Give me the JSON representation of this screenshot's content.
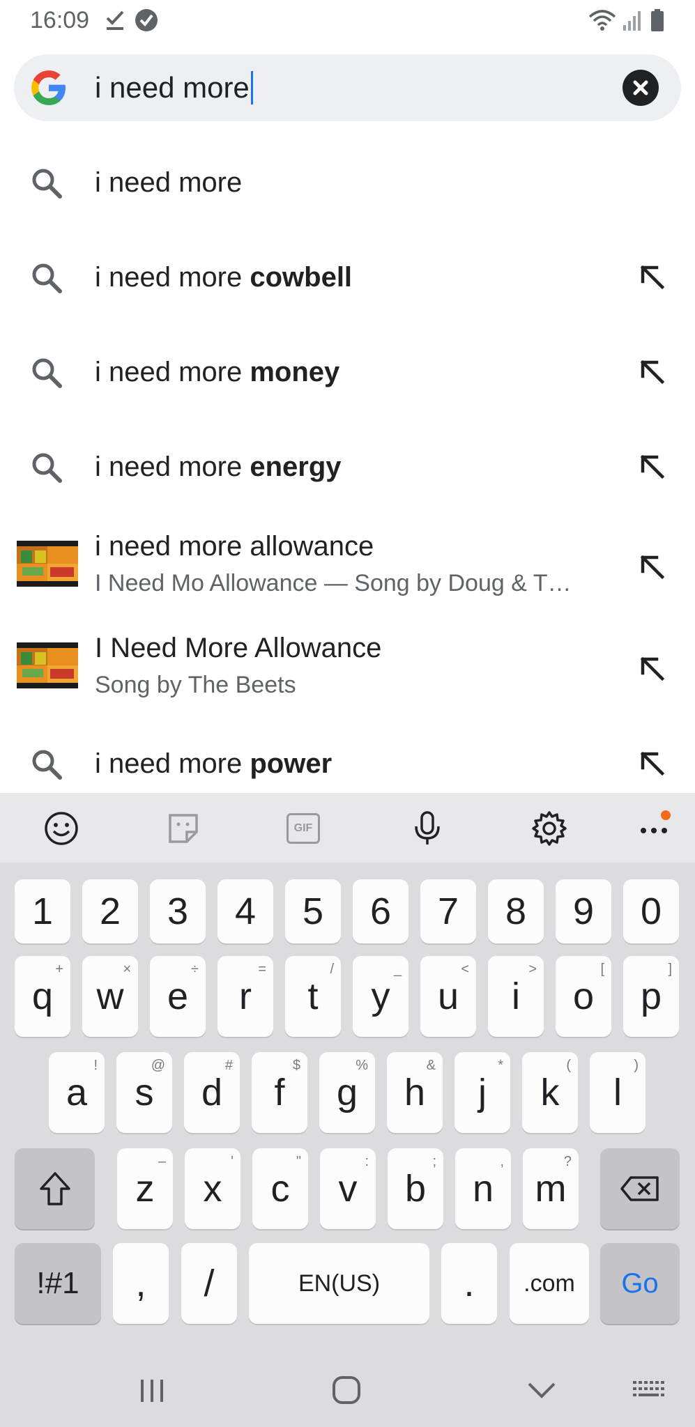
{
  "status_bar": {
    "time": "16:09"
  },
  "search": {
    "query": "i need more"
  },
  "suggestions": [
    {
      "type": "query",
      "prefix": "i need more",
      "bold": ""
    },
    {
      "type": "query",
      "prefix": "i need more ",
      "bold": "cowbell"
    },
    {
      "type": "query",
      "prefix": "i need more ",
      "bold": "money"
    },
    {
      "type": "query",
      "prefix": "i need more ",
      "bold": "energy"
    },
    {
      "type": "media",
      "title": "i need more allowance",
      "subtitle": "I Need Mo Allowance — Song by Doug & T…"
    },
    {
      "type": "media",
      "title": "I Need More Allowance",
      "subtitle": "Song by The Beets"
    },
    {
      "type": "query",
      "prefix": "i need more ",
      "bold": "power"
    }
  ],
  "keyboard": {
    "toolbar": [
      "emoji-icon",
      "sticker-icon",
      "gif-icon",
      "microphone-icon",
      "settings-icon",
      "more-icon"
    ],
    "gif_label": "GIF",
    "number_row": [
      "1",
      "2",
      "3",
      "4",
      "5",
      "6",
      "7",
      "8",
      "9",
      "0"
    ],
    "row1": [
      {
        "k": "q",
        "h": "+"
      },
      {
        "k": "w",
        "h": "×"
      },
      {
        "k": "e",
        "h": "÷"
      },
      {
        "k": "r",
        "h": "="
      },
      {
        "k": "t",
        "h": "/"
      },
      {
        "k": "y",
        "h": "_"
      },
      {
        "k": "u",
        "h": "<"
      },
      {
        "k": "i",
        "h": ">"
      },
      {
        "k": "o",
        "h": "["
      },
      {
        "k": "p",
        "h": "]"
      }
    ],
    "row2": [
      {
        "k": "a",
        "h": "!"
      },
      {
        "k": "s",
        "h": "@"
      },
      {
        "k": "d",
        "h": "#"
      },
      {
        "k": "f",
        "h": "$"
      },
      {
        "k": "g",
        "h": "%"
      },
      {
        "k": "h",
        "h": "&"
      },
      {
        "k": "j",
        "h": "*"
      },
      {
        "k": "k",
        "h": "("
      },
      {
        "k": "l",
        "h": ")"
      }
    ],
    "row3": [
      {
        "k": "z",
        "h": "–"
      },
      {
        "k": "x",
        "h": "'"
      },
      {
        "k": "c",
        "h": "\""
      },
      {
        "k": "v",
        "h": ":"
      },
      {
        "k": "b",
        "h": ";"
      },
      {
        "k": "n",
        "h": ","
      },
      {
        "k": "m",
        "h": "?"
      }
    ],
    "symbols_label": "!#1",
    "comma_label": ",",
    "slash_label": "/",
    "space_label": "EN(US)",
    "period_label": ".",
    "dotcom_label": ".com",
    "go_label": "Go"
  },
  "colors": {
    "accent": "#1a73e8",
    "notification_dot": "#f26b1d"
  }
}
